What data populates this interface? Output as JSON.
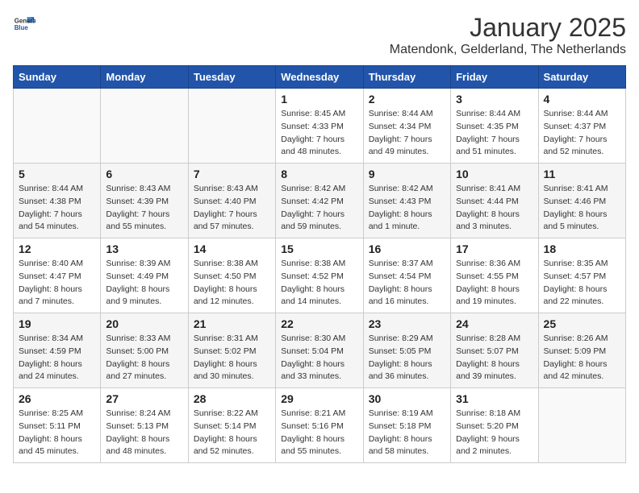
{
  "logo": {
    "text_general": "General",
    "text_blue": "Blue"
  },
  "title": "January 2025",
  "location": "Matendonk, Gelderland, The Netherlands",
  "weekdays": [
    "Sunday",
    "Monday",
    "Tuesday",
    "Wednesday",
    "Thursday",
    "Friday",
    "Saturday"
  ],
  "weeks": [
    [
      {
        "day": "",
        "info": ""
      },
      {
        "day": "",
        "info": ""
      },
      {
        "day": "",
        "info": ""
      },
      {
        "day": "1",
        "info": "Sunrise: 8:45 AM\nSunset: 4:33 PM\nDaylight: 7 hours\nand 48 minutes."
      },
      {
        "day": "2",
        "info": "Sunrise: 8:44 AM\nSunset: 4:34 PM\nDaylight: 7 hours\nand 49 minutes."
      },
      {
        "day": "3",
        "info": "Sunrise: 8:44 AM\nSunset: 4:35 PM\nDaylight: 7 hours\nand 51 minutes."
      },
      {
        "day": "4",
        "info": "Sunrise: 8:44 AM\nSunset: 4:37 PM\nDaylight: 7 hours\nand 52 minutes."
      }
    ],
    [
      {
        "day": "5",
        "info": "Sunrise: 8:44 AM\nSunset: 4:38 PM\nDaylight: 7 hours\nand 54 minutes."
      },
      {
        "day": "6",
        "info": "Sunrise: 8:43 AM\nSunset: 4:39 PM\nDaylight: 7 hours\nand 55 minutes."
      },
      {
        "day": "7",
        "info": "Sunrise: 8:43 AM\nSunset: 4:40 PM\nDaylight: 7 hours\nand 57 minutes."
      },
      {
        "day": "8",
        "info": "Sunrise: 8:42 AM\nSunset: 4:42 PM\nDaylight: 7 hours\nand 59 minutes."
      },
      {
        "day": "9",
        "info": "Sunrise: 8:42 AM\nSunset: 4:43 PM\nDaylight: 8 hours\nand 1 minute."
      },
      {
        "day": "10",
        "info": "Sunrise: 8:41 AM\nSunset: 4:44 PM\nDaylight: 8 hours\nand 3 minutes."
      },
      {
        "day": "11",
        "info": "Sunrise: 8:41 AM\nSunset: 4:46 PM\nDaylight: 8 hours\nand 5 minutes."
      }
    ],
    [
      {
        "day": "12",
        "info": "Sunrise: 8:40 AM\nSunset: 4:47 PM\nDaylight: 8 hours\nand 7 minutes."
      },
      {
        "day": "13",
        "info": "Sunrise: 8:39 AM\nSunset: 4:49 PM\nDaylight: 8 hours\nand 9 minutes."
      },
      {
        "day": "14",
        "info": "Sunrise: 8:38 AM\nSunset: 4:50 PM\nDaylight: 8 hours\nand 12 minutes."
      },
      {
        "day": "15",
        "info": "Sunrise: 8:38 AM\nSunset: 4:52 PM\nDaylight: 8 hours\nand 14 minutes."
      },
      {
        "day": "16",
        "info": "Sunrise: 8:37 AM\nSunset: 4:54 PM\nDaylight: 8 hours\nand 16 minutes."
      },
      {
        "day": "17",
        "info": "Sunrise: 8:36 AM\nSunset: 4:55 PM\nDaylight: 8 hours\nand 19 minutes."
      },
      {
        "day": "18",
        "info": "Sunrise: 8:35 AM\nSunset: 4:57 PM\nDaylight: 8 hours\nand 22 minutes."
      }
    ],
    [
      {
        "day": "19",
        "info": "Sunrise: 8:34 AM\nSunset: 4:59 PM\nDaylight: 8 hours\nand 24 minutes."
      },
      {
        "day": "20",
        "info": "Sunrise: 8:33 AM\nSunset: 5:00 PM\nDaylight: 8 hours\nand 27 minutes."
      },
      {
        "day": "21",
        "info": "Sunrise: 8:31 AM\nSunset: 5:02 PM\nDaylight: 8 hours\nand 30 minutes."
      },
      {
        "day": "22",
        "info": "Sunrise: 8:30 AM\nSunset: 5:04 PM\nDaylight: 8 hours\nand 33 minutes."
      },
      {
        "day": "23",
        "info": "Sunrise: 8:29 AM\nSunset: 5:05 PM\nDaylight: 8 hours\nand 36 minutes."
      },
      {
        "day": "24",
        "info": "Sunrise: 8:28 AM\nSunset: 5:07 PM\nDaylight: 8 hours\nand 39 minutes."
      },
      {
        "day": "25",
        "info": "Sunrise: 8:26 AM\nSunset: 5:09 PM\nDaylight: 8 hours\nand 42 minutes."
      }
    ],
    [
      {
        "day": "26",
        "info": "Sunrise: 8:25 AM\nSunset: 5:11 PM\nDaylight: 8 hours\nand 45 minutes."
      },
      {
        "day": "27",
        "info": "Sunrise: 8:24 AM\nSunset: 5:13 PM\nDaylight: 8 hours\nand 48 minutes."
      },
      {
        "day": "28",
        "info": "Sunrise: 8:22 AM\nSunset: 5:14 PM\nDaylight: 8 hours\nand 52 minutes."
      },
      {
        "day": "29",
        "info": "Sunrise: 8:21 AM\nSunset: 5:16 PM\nDaylight: 8 hours\nand 55 minutes."
      },
      {
        "day": "30",
        "info": "Sunrise: 8:19 AM\nSunset: 5:18 PM\nDaylight: 8 hours\nand 58 minutes."
      },
      {
        "day": "31",
        "info": "Sunrise: 8:18 AM\nSunset: 5:20 PM\nDaylight: 9 hours\nand 2 minutes."
      },
      {
        "day": "",
        "info": ""
      }
    ]
  ]
}
